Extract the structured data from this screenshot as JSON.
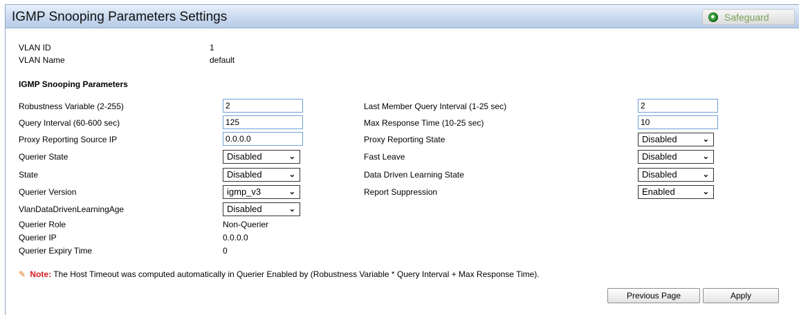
{
  "header": {
    "title": "IGMP Snooping Parameters Settings",
    "safeguard_label": "Safeguard"
  },
  "vlan": {
    "id_label": "VLAN ID",
    "id_value": "1",
    "name_label": "VLAN Name",
    "name_value": "default"
  },
  "section_title": "IGMP Snooping Parameters",
  "left": {
    "robustness_label": "Robustness Variable (2-255)",
    "robustness_value": "2",
    "query_interval_label": "Query Interval (60-600 sec)",
    "query_interval_value": "125",
    "proxy_ip_label": "Proxy Reporting Source IP",
    "proxy_ip_value": "0.0.0.0",
    "querier_state_label": "Querier State",
    "querier_state_value": "Disabled",
    "state_label": "State",
    "state_value": "Disabled",
    "querier_version_label": "Querier Version",
    "querier_version_value": "igmp_v3",
    "vlan_ddl_age_label": "VlanDataDrivenLearningAge",
    "vlan_ddl_age_value": "Disabled",
    "querier_role_label": "Querier Role",
    "querier_role_value": "Non-Querier",
    "querier_ip_label": "Querier IP",
    "querier_ip_value": "0.0.0.0",
    "querier_expiry_label": "Querier Expiry Time",
    "querier_expiry_value": "0"
  },
  "right": {
    "last_member_label": "Last Member Query Interval (1-25 sec)",
    "last_member_value": "2",
    "max_response_label": "Max Response Time (10-25 sec)",
    "max_response_value": "10",
    "proxy_state_label": "Proxy Reporting State",
    "proxy_state_value": "Disabled",
    "fast_leave_label": "Fast Leave",
    "fast_leave_value": "Disabled",
    "ddl_state_label": "Data Driven Learning State",
    "ddl_state_value": "Disabled",
    "report_suppression_label": "Report Suppression",
    "report_suppression_value": "Enabled"
  },
  "note": {
    "label": "Note:",
    "text": "The Host Timeout was computed automatically in Querier Enabled by (Robustness Variable * Query Interval + Max Response Time)."
  },
  "buttons": {
    "previous": "Previous Page",
    "apply": "Apply"
  },
  "icons": {
    "dropdown": "chevron-down-icon",
    "note": "pencil-icon",
    "safeguard": "green-status-dot-icon"
  }
}
